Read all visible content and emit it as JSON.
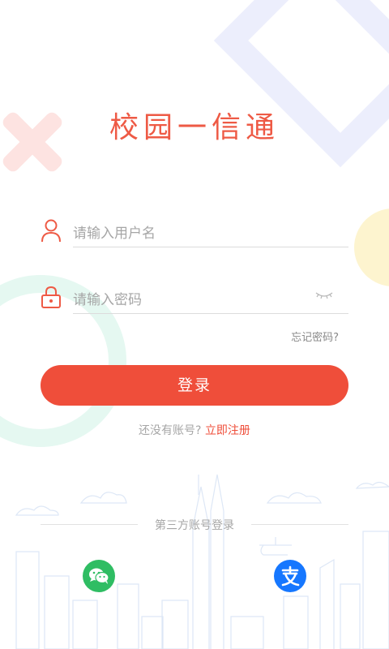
{
  "app": {
    "title": "校园一信通"
  },
  "form": {
    "username_placeholder": "请输入用户名",
    "password_placeholder": "请输入密码",
    "forgot_label": "忘记密码?",
    "login_label": "登录"
  },
  "register": {
    "question": "还没有账号?",
    "link": "立即注册"
  },
  "third_party": {
    "label": "第三方账号登录",
    "providers": [
      {
        "icon": "wechat-icon",
        "color": "#2fbd63"
      },
      {
        "icon": "alipay-icon",
        "color": "#1677ff"
      }
    ]
  },
  "colors": {
    "accent": "#ef4e3a",
    "title": "#ee5a45"
  }
}
